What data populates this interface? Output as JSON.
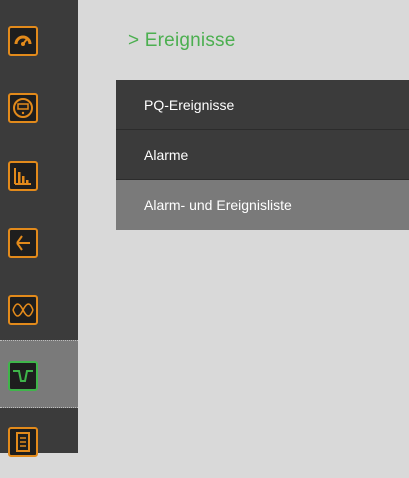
{
  "breadcrumb": {
    "text": "> Ereignisse"
  },
  "rail": {
    "items": [
      {
        "icon": "gauge-icon"
      },
      {
        "icon": "meter-icon"
      },
      {
        "icon": "bar-chart-icon"
      },
      {
        "icon": "vector-diagram-icon"
      },
      {
        "icon": "waveform-icon"
      },
      {
        "icon": "event-dip-icon",
        "active": true
      },
      {
        "icon": "document-list-icon"
      }
    ]
  },
  "menu": {
    "items": [
      {
        "label": "PQ-Ereignisse"
      },
      {
        "label": "Alarme"
      },
      {
        "label": "Alarm- und Ereignisliste",
        "selected": true
      }
    ]
  },
  "colors": {
    "accent_orange": "#e28a1b",
    "accent_green": "#3fb54a",
    "breadcrumb_green": "#4caf50",
    "rail_bg": "#3b3b3b",
    "content_bg": "#d9d9d9",
    "selected_bg": "#7a7a7a"
  }
}
